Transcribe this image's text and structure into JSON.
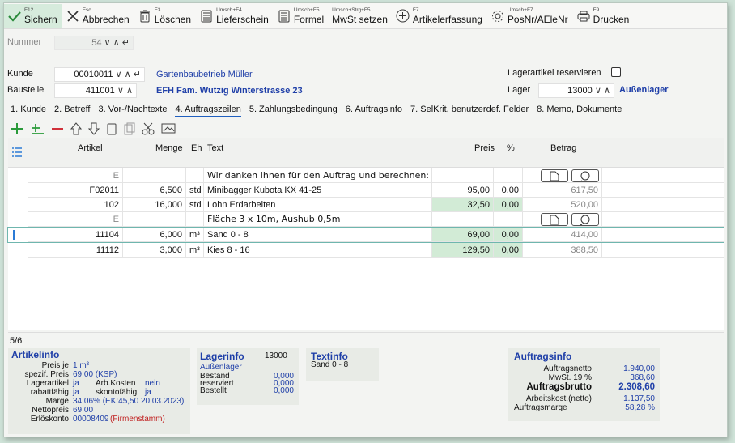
{
  "toolbar": {
    "save": {
      "key": "F12",
      "label": "Sichern"
    },
    "cancel": {
      "key": "Esc",
      "label": "Abbrechen"
    },
    "delete": {
      "key": "F3",
      "label": "Löschen"
    },
    "delivery": {
      "key": "Umsch+F4",
      "label": "Lieferschein"
    },
    "formula": {
      "key": "Umsch+F5",
      "label": "Formel"
    },
    "vat": {
      "key": "Umsch+Strg+F5",
      "label": "MwSt setzen"
    },
    "article": {
      "key": "F7",
      "label": "Artikelerfassung"
    },
    "posnr": {
      "key": "Umsch+F7",
      "label": "PosNr/AEleNr"
    },
    "print": {
      "key": "F9",
      "label": "Drucken"
    }
  },
  "header": {
    "nummer_label": "Nummer",
    "nummer_value": "54",
    "kunde_label": "Kunde",
    "kunde_value": "00010011",
    "kunde_name": "Gartenbaubetrieb Müller",
    "baustelle_label": "Baustelle",
    "baustelle_value": "411001",
    "baustelle_name": "EFH Fam. Wutzig Winterstrasse 23",
    "reserve_label": "Lagerartikel reservieren",
    "lager_label": "Lager",
    "lager_value": "13000",
    "lager_name": "Außenlager"
  },
  "tabs": [
    "1. Kunde",
    "2. Betreff",
    "3. Vor-/Nachtexte",
    "4. Auftragszeilen",
    "5. Zahlungsbedingung",
    "6. Auftragsinfo",
    "7. SelKrit, benutzerdef. Felder",
    "8. Memo, Dokumente"
  ],
  "grid": {
    "columns": {
      "artikel": "Artikel",
      "menge": "Menge",
      "eh": "Eh",
      "text": "Text",
      "preis": "Preis",
      "pct": "%",
      "betrag": "Betrag"
    },
    "rows": [
      {
        "artikel": "E",
        "menge": "",
        "eh": "",
        "text": "Wir danken Ihnen für den Auftrag und berechnen:",
        "preis": "",
        "pct": "",
        "betrag": ""
      },
      {
        "artikel": "F02011",
        "menge": "6,500",
        "eh": "std",
        "text": "Minibagger Kubota KX 41-25",
        "preis": "95,00",
        "pct": "0,00",
        "betrag": "617,50"
      },
      {
        "artikel": "102",
        "menge": "16,000",
        "eh": "std",
        "text": "Lohn Erdarbeiten",
        "preis": "32,50",
        "pct": "0,00",
        "betrag": "520,00"
      },
      {
        "artikel": "E",
        "menge": "",
        "eh": "",
        "text": "Fläche 3 x 10m, Aushub 0,5m",
        "preis": "",
        "pct": "",
        "betrag": ""
      },
      {
        "artikel": "11104",
        "menge": "6,000",
        "eh": "m³",
        "text": "Sand 0 - 8",
        "preis": "69,00",
        "pct": "0,00",
        "betrag": "414,00"
      },
      {
        "artikel": "11112",
        "menge": "3,000",
        "eh": "m³",
        "text": "Kies 8 - 16",
        "preis": "129,50",
        "pct": "0,00",
        "betrag": "388,50"
      }
    ]
  },
  "status": "5/6",
  "artikelinfo": {
    "title": "Artikelinfo",
    "preis_je_label": "Preis je",
    "preis_je": "1 m³",
    "spezif_label": "spezif. Preis",
    "spezif": "69,00 (KSP)",
    "lagerartikel_label": "Lagerartikel",
    "lagerartikel": "ja",
    "arbkosten_label": "Arb.Kosten",
    "arbkosten": "nein",
    "rabatt_label": "rabattfähig",
    "rabatt": "ja",
    "skonto_label": "skontofähig",
    "skonto": "ja",
    "marge_label": "Marge",
    "marge": "34,06% (EK:45,50  20.03.2023)",
    "netto_label": "Nettopreis",
    "netto": "69,00",
    "erloes_label": "Erlöskonto",
    "erloes": "00008409",
    "erloes_note": "(Firmenstamm)"
  },
  "lagerinfo": {
    "title": "Lagerinfo",
    "lager": "13000",
    "name": "Außenlager",
    "bestand_label": "Bestand",
    "bestand": "0,000",
    "reserviert_label": "reserviert",
    "reserviert": "0,000",
    "bestellt_label": "Bestellt",
    "bestellt": "0,000"
  },
  "textinfo": {
    "title": "Textinfo",
    "text": "Sand 0 - 8"
  },
  "auftragsinfo": {
    "title": "Auftragsinfo",
    "netto_label": "Auftragsnetto",
    "netto": "1.940,00",
    "mwst_label": "MwSt. 19 %",
    "mwst": "368,60",
    "brutto_label": "Auftragsbrutto",
    "brutto": "2.308,60",
    "arbkost_label": "Arbeitskost.(netto)",
    "arbkost": "1.137,50",
    "marge_label": "Auftragsmarge",
    "marge": "58,28 %"
  }
}
